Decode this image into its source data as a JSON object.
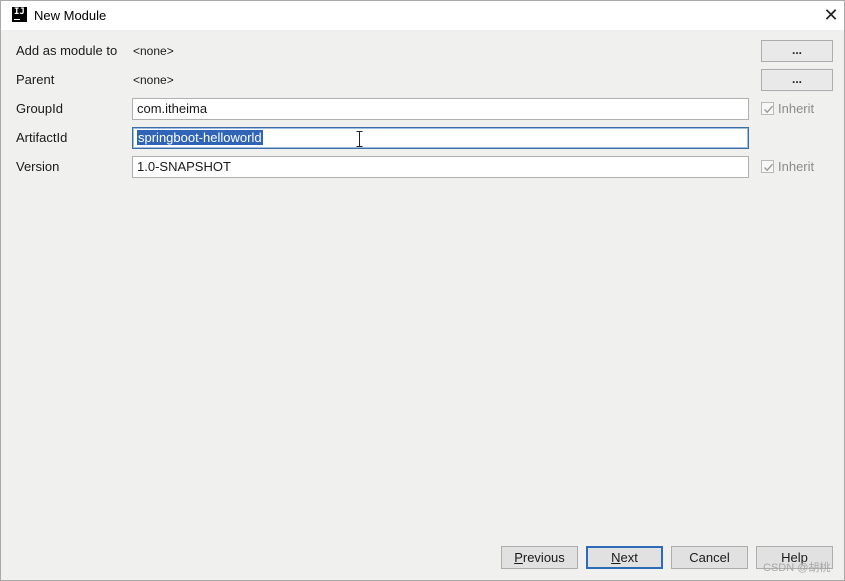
{
  "window": {
    "title": "New Module",
    "app_icon_text": "IJ",
    "close_glyph": "✕"
  },
  "form": {
    "add_as_module": {
      "label": "Add as module to",
      "value": "<none>",
      "button": "..."
    },
    "parent": {
      "label": "Parent",
      "value": "<none>",
      "button": "..."
    },
    "group_id": {
      "label": "GroupId",
      "value": "com.itheima",
      "inherit_label": "Inherit",
      "inherit_checked": true
    },
    "artifact_id": {
      "label": "ArtifactId",
      "value": "springboot-helloworld"
    },
    "version": {
      "label": "Version",
      "value": "1.0-SNAPSHOT",
      "inherit_label": "Inherit",
      "inherit_checked": true
    }
  },
  "footer": {
    "previous": {
      "mnemonic": "P",
      "rest": "revious"
    },
    "next": {
      "mnemonic": "N",
      "rest": "ext"
    },
    "cancel": "Cancel",
    "help": "Help"
  },
  "watermark": "CSDN @胡桃",
  "colors": {
    "selection": "#2f64b6",
    "focus_border": "#3a6ea5",
    "default_button_border": "#2d6ab8",
    "dialog_bg": "#f0f0ef"
  }
}
